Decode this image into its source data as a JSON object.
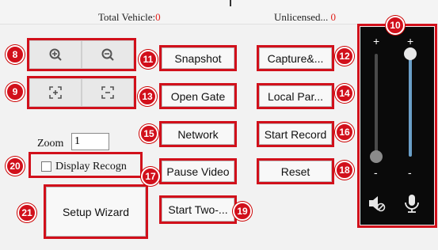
{
  "header": {
    "total_vehicle_label": "Total Vehicle:",
    "total_vehicle_value": "0",
    "unlicensed_label": "Unlicensed...",
    "unlicensed_value": "0"
  },
  "zoom": {
    "label": "Zoom",
    "value": "1"
  },
  "display_recognition": {
    "label": "Display Recogn",
    "checked": false
  },
  "buttons": {
    "snapshot": "Snapshot",
    "capture": "Capture&...",
    "open_gate": "Open Gate",
    "local_param": "Local Par...",
    "network": "Network",
    "start_record": "Start Record",
    "pause_video": "Pause Video",
    "reset": "Reset",
    "start_two_way": "Start Two-...",
    "setup_wizard": "Setup Wizard"
  },
  "icons": {
    "zoom_in": "zoom-in-icon",
    "zoom_out": "zoom-out-icon",
    "expand": "expand-icon",
    "shrink": "shrink-icon",
    "speaker_mute": "speaker-mute-icon",
    "microphone": "microphone-icon"
  },
  "volume": {
    "speaker_plus": "+",
    "speaker_minus": "-",
    "mic_plus": "+",
    "mic_minus": "-",
    "speaker_level": 0.0,
    "mic_level": 1.0
  },
  "annotations": [
    "8",
    "9",
    "10",
    "11",
    "12",
    "13",
    "14",
    "15",
    "16",
    "17",
    "18",
    "19",
    "20",
    "21"
  ],
  "colors": {
    "accent_red": "#d1101b",
    "side_panel": "#0a0a0a",
    "slider_blue": "#6a9fc8"
  }
}
